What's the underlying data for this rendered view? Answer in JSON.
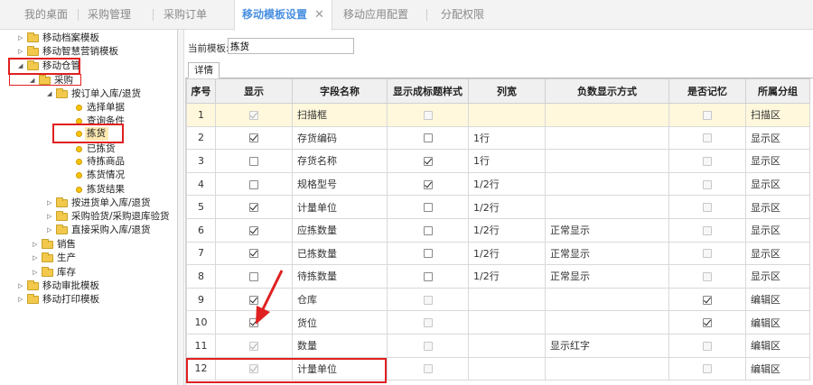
{
  "tabs": [
    {
      "label": "我的桌面",
      "active": false
    },
    {
      "label": "采购管理",
      "active": false
    },
    {
      "label": "采购订单",
      "active": false
    },
    {
      "label": "移动模板设置",
      "active": true,
      "close": "✕"
    },
    {
      "label": "移动应用配置",
      "active": false
    },
    {
      "label": "分配权限",
      "active": false
    }
  ],
  "tree": {
    "mobile_archive": "移动档案模板",
    "smart_marketing": "移动智慧营销模板",
    "mobile_warehouse": "移动仓管",
    "purchase": "采购",
    "order_in_return": "按订单入库/退货",
    "select_doc": "选择单据",
    "query_cond": "查询条件",
    "picking": "拣货",
    "picked": "已拣货",
    "to_pick": "待拣商品",
    "pick_status": "拣货情况",
    "pick_result": "拣货结果",
    "arrival_in_return": "按进货单入库/退货",
    "purchase_inspect": "采购验货/采购退库验货",
    "direct_in_return": "直接采购入库/退货",
    "sales": "销售",
    "production": "生产",
    "inventory": "库存",
    "approval": "移动审批模板",
    "print": "移动打印模板"
  },
  "current_template": {
    "label": "当前模板:",
    "value": "拣货"
  },
  "subtab": "详情",
  "table": {
    "headers": [
      "序号",
      "显示",
      "字段名称",
      "显示成标题样式",
      "列宽",
      "负数显示方式",
      "是否记忆",
      "所属分组"
    ],
    "rows": [
      {
        "no": "1",
        "show": true,
        "show_disabled": true,
        "name": "扫描框",
        "title": false,
        "title_disabled": true,
        "width": "",
        "neg": "",
        "mem": false,
        "group": "扫描区"
      },
      {
        "no": "2",
        "show": true,
        "show_disabled": false,
        "name": "存货编码",
        "title": false,
        "title_disabled": false,
        "width": "1行",
        "neg": "",
        "mem": false,
        "group": "显示区"
      },
      {
        "no": "3",
        "show": false,
        "show_disabled": false,
        "name": "存货名称",
        "title": true,
        "title_disabled": false,
        "width": "1行",
        "neg": "",
        "mem": false,
        "group": "显示区"
      },
      {
        "no": "4",
        "show": false,
        "show_disabled": false,
        "name": "规格型号",
        "title": true,
        "title_disabled": false,
        "width": "1/2行",
        "neg": "",
        "mem": false,
        "group": "显示区"
      },
      {
        "no": "5",
        "show": true,
        "show_disabled": false,
        "name": "计量单位",
        "title": false,
        "title_disabled": false,
        "width": "1/2行",
        "neg": "",
        "mem": false,
        "group": "显示区"
      },
      {
        "no": "6",
        "show": true,
        "show_disabled": false,
        "name": "应拣数量",
        "title": false,
        "title_disabled": false,
        "width": "1/2行",
        "neg": "正常显示",
        "mem": false,
        "group": "显示区"
      },
      {
        "no": "7",
        "show": true,
        "show_disabled": false,
        "name": "已拣数量",
        "title": false,
        "title_disabled": false,
        "width": "1/2行",
        "neg": "正常显示",
        "mem": false,
        "group": "显示区"
      },
      {
        "no": "8",
        "show": false,
        "show_disabled": false,
        "name": "待拣数量",
        "title": false,
        "title_disabled": false,
        "width": "1/2行",
        "neg": "正常显示",
        "mem": false,
        "group": "显示区"
      },
      {
        "no": "9",
        "show": true,
        "show_disabled": false,
        "name": "仓库",
        "title": false,
        "title_disabled": true,
        "width": "",
        "neg": "",
        "mem": true,
        "group": "编辑区"
      },
      {
        "no": "10",
        "show": true,
        "show_disabled": false,
        "name": "货位",
        "title": false,
        "title_disabled": true,
        "width": "",
        "neg": "",
        "mem": true,
        "group": "编辑区"
      },
      {
        "no": "11",
        "show": true,
        "show_disabled": true,
        "name": "数量",
        "title": false,
        "title_disabled": true,
        "width": "",
        "neg": "显示红字",
        "mem": false,
        "group": "编辑区"
      },
      {
        "no": "12",
        "show": true,
        "show_disabled": true,
        "name": "计量单位",
        "title": false,
        "title_disabled": true,
        "width": "",
        "neg": "",
        "mem": false,
        "group": "编辑区"
      }
    ]
  },
  "colors": {
    "accent": "#4a90e2",
    "highlight_row": "#fff8dc",
    "annotation": "#e02020",
    "folder": "#f2c94c",
    "leaf_dot": "#f5c400"
  }
}
